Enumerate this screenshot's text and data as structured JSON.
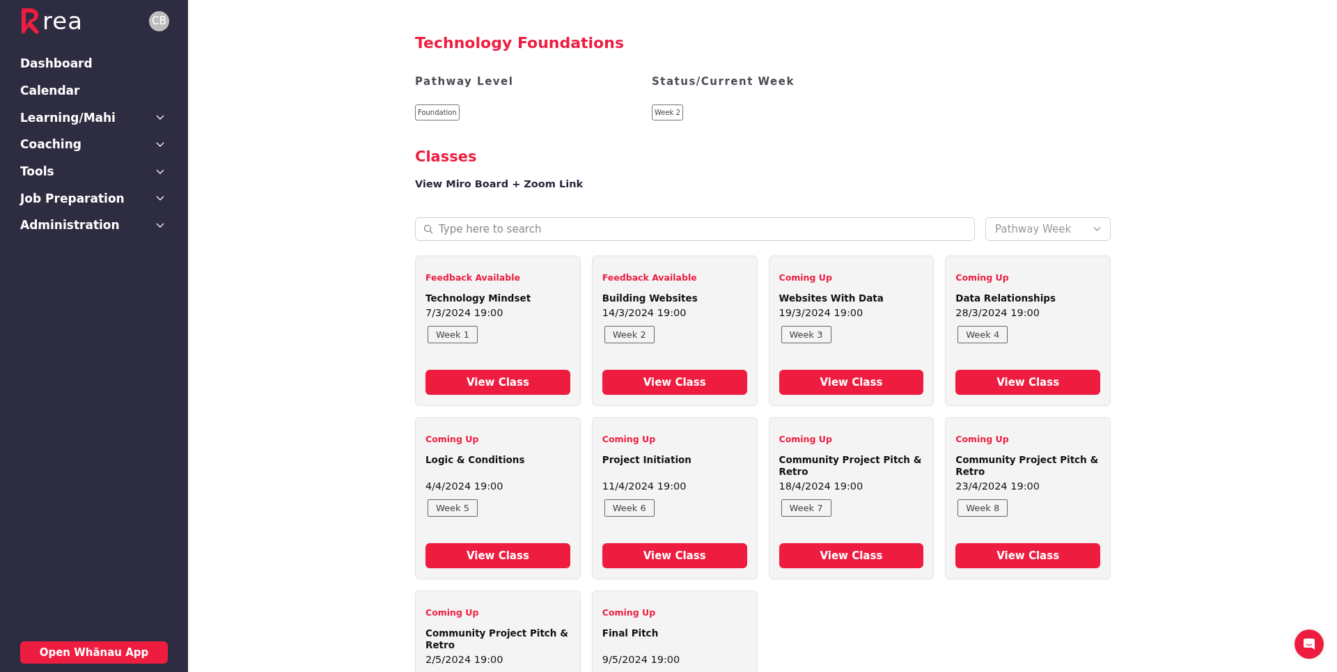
{
  "sidebar": {
    "logo_text": "rea",
    "avatar": "CB",
    "items": [
      {
        "label": "Dashboard",
        "expandable": false
      },
      {
        "label": "Calendar",
        "expandable": false
      },
      {
        "label": "Learning/Mahi",
        "expandable": true
      },
      {
        "label": "Coaching",
        "expandable": true
      },
      {
        "label": "Tools",
        "expandable": true
      },
      {
        "label": "Job Preparation",
        "expandable": true
      },
      {
        "label": "Administration",
        "expandable": true
      }
    ],
    "bottom_button": "Open Whānau App"
  },
  "page": {
    "title": "Technology Foundations",
    "fields": [
      {
        "label": "Pathway Level",
        "value": "Foundation"
      },
      {
        "label": "Status/Current Week",
        "value": "Week 2"
      }
    ],
    "section_title": "Classes",
    "link": "View Miro Board + Zoom Link",
    "search": {
      "placeholder": "Type here to search"
    },
    "filter": {
      "value": "Pathway Week"
    },
    "classes": [
      {
        "status": "Feedback Available",
        "title": "Technology Mindset",
        "date": "7/3/2024 19:00",
        "week": "Week 1",
        "button": "View Class"
      },
      {
        "status": "Feedback Available",
        "title": "Building Websites",
        "date": "14/3/2024 19:00",
        "week": "Week 2",
        "button": "View Class"
      },
      {
        "status": "Coming Up",
        "title": "Websites With Data",
        "date": "19/3/2024 19:00",
        "week": "Week 3",
        "button": "View Class"
      },
      {
        "status": "Coming Up",
        "title": "Data Relationships",
        "date": "28/3/2024 19:00",
        "week": "Week 4",
        "button": "View Class"
      },
      {
        "status": "Coming Up",
        "title": "Logic & Conditions",
        "date": "4/4/2024 19:00",
        "week": "Week 5",
        "button": "View Class"
      },
      {
        "status": "Coming Up",
        "title": "Project Initiation",
        "date": "11/4/2024 19:00",
        "week": "Week 6",
        "button": "View Class"
      },
      {
        "status": "Coming Up",
        "title": "Community Project Pitch & Retro",
        "date": "18/4/2024 19:00",
        "week": "Week 7",
        "button": "View Class"
      },
      {
        "status": "Coming Up",
        "title": "Community Project Pitch & Retro",
        "date": "23/4/2024 19:00",
        "week": "Week 8",
        "button": "View Class"
      },
      {
        "status": "Coming Up",
        "title": "Community Project Pitch & Retro",
        "date": "2/5/2024 19:00"
      },
      {
        "status": "Coming Up",
        "title": "Final Pitch",
        "date": "9/5/2024 19:00"
      }
    ]
  }
}
